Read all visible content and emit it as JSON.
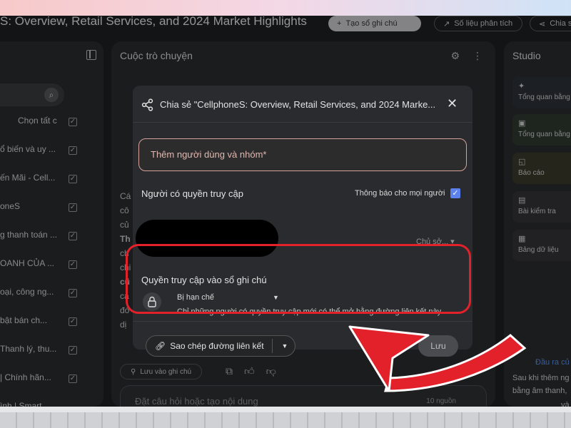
{
  "window": {
    "title": "S: Overview, Retail Services, and 2024 Market Highlights",
    "create_note_label": "Tạo sổ ghi chú",
    "stats_label": "Số liệu phân tích",
    "share_label": "Chia s"
  },
  "sources": {
    "select_all_label": "Chọn tất cả",
    "items": [
      "ổ biến và uy ...",
      "ến Mãi - Cell...",
      "oneS",
      "g thanh toán ...",
      "OANH CỦA ...",
      "oại, công ng...",
      "bật bán ch...",
      "Thanh lý, thu...",
      "| Chính hãn...",
      "ình | Smart"
    ]
  },
  "chat": {
    "title": "Cuộc trò chuyện",
    "fragments": [
      "Cá",
      "cô",
      "củ",
      "Th",
      "ch",
      "chi",
      "cũ",
      "cá",
      "đó",
      "dị"
    ],
    "save_note_label": "Lưu vào ghi chú",
    "composer_placeholder": "Đặt câu hỏi hoặc tạo nội dung",
    "source_count": "10 nguồn"
  },
  "studio": {
    "title": "Studio",
    "cards": [
      "Tổng quan bằng",
      "Tổng quan bằng",
      "Báo cáo",
      "Bài kiểm tra",
      "Bảng dữ liệu"
    ],
    "link": "Đầu ra củ",
    "notes": [
      "Sau khi thêm ng",
      "bằng âm thanh,",
      "và"
    ]
  },
  "dialog": {
    "title": "Chia sẻ \"CellphoneS: Overview, Retail Services, and 2024 Marke...",
    "add_people_placeholder": "Thêm người dùng và nhóm*",
    "access_title": "Người có quyền truy cập",
    "notify_label": "Thông báo cho mọi người",
    "notify_checked": true,
    "owner_role": "Chủ sở...",
    "notebook_access_title": "Quyền truy cập vào sổ ghi chú",
    "restricted_label": "Bị hạn chế",
    "restricted_description": "Chỉ những người có quyền truy cập mới có thể mở bằng đường liên kết này",
    "copy_link_label": "Sao chép đường liên kết",
    "save_label": "Lưu"
  },
  "colors": {
    "highlight": "#e2212a",
    "accent_blue": "#5b82ef",
    "input_border": "#d5a39b"
  }
}
